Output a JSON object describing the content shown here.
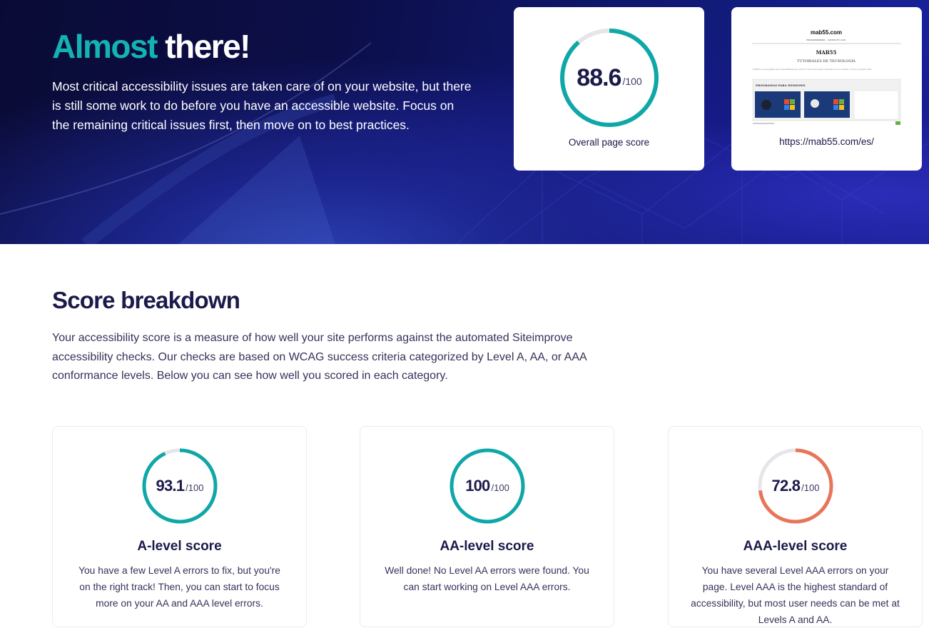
{
  "hero": {
    "title_accent": "Almost",
    "title_rest": "there!",
    "description": "Most critical accessibility issues are taken care of on your website, but there is still some work to do before you have an accessible website. Focus on the remaining critical issues first, then move on to best practices."
  },
  "overall": {
    "score": "88.6",
    "max": "/100",
    "fraction": 0.886,
    "caption": "Overall page score",
    "color": "#0fa7a8"
  },
  "screenshot": {
    "site_logo": "mab55.com",
    "nav": [
      "PROGRAMAS",
      "SIMA",
      "CONTACTO",
      "CLIR"
    ],
    "heading": "MAB55",
    "subheading": "TUTORIALES DE TECNOLOGÍA",
    "tagline": "MAB55 es una página web especializada en el sector de la tecnología, dispositivos de consumo, cursos y guardo más...",
    "section_label": "PROGRAMAS PARA WINDOWS",
    "url": "https://mab55.com/es/"
  },
  "breakdown": {
    "title": "Score breakdown",
    "description": "Your accessibility score is a measure of how well your site performs against the automated Siteimprove accessibility checks. Our checks are based on WCAG success criteria categorized by Level A, AA, or AAA conformance levels. Below you can see how well you scored in each category."
  },
  "levels": [
    {
      "score": "93.1",
      "max": "/100",
      "fraction": 0.931,
      "color": "#0fa7a8",
      "title": "A-level score",
      "text": "You have a few Level A errors to fix, but you're on the right track! Then, you can start to focus more on your AA and AAA level errors."
    },
    {
      "score": "100",
      "max": "/100",
      "fraction": 1.0,
      "color": "#0fa7a8",
      "title": "AA-level score",
      "text": "Well done! No Level AA errors were found. You can start working on Level AAA errors."
    },
    {
      "score": "72.8",
      "max": "/100",
      "fraction": 0.728,
      "color": "#e8755a",
      "title": "AAA-level score",
      "text": "You have several Level AAA errors on your page. Level AAA is the highest standard of accessibility, but most user needs can be met at Levels A and AA."
    }
  ]
}
